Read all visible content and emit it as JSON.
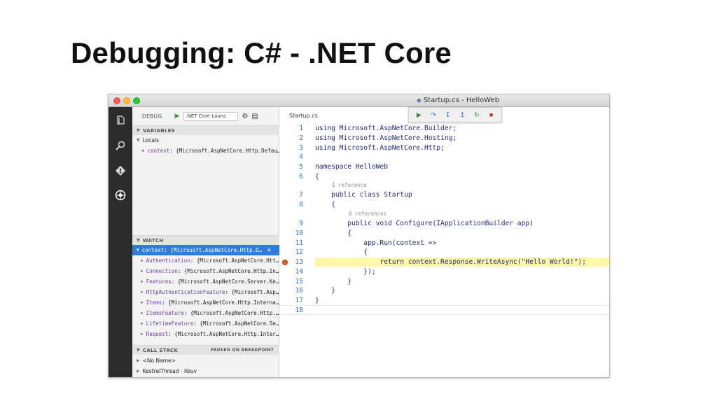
{
  "slide": {
    "title": "Debugging: C# - .NET Core"
  },
  "window": {
    "title": "Startup.cs - HelloWeb"
  },
  "activity_bar": {
    "icons": [
      "files-icon",
      "search-icon",
      "git-icon",
      "debug-icon"
    ]
  },
  "sidebar": {
    "debug_label": "DEBUG",
    "launch_config": ".NET Core Launc",
    "variables_header": "VARIABLES",
    "locals_label": "Locals",
    "locals": [
      {
        "key": "context",
        "value": ": {Microsoft.AspNetCore.Http.Defau…"
      }
    ],
    "watch_header": "WATCH",
    "watch_items": [
      {
        "key": "context",
        "value": ": {Microsoft.AspNetCore.Http.D…"
      },
      {
        "key": "Authentication",
        "value": ": {Microsoft.AspNetCore.Htt…"
      },
      {
        "key": "Connection",
        "value": ": {Microsoft.AspNetCore.Http.In…"
      },
      {
        "key": "Features",
        "value": ": {Microsoft.AspNetCore.Server.Ke…"
      },
      {
        "key": "HttpAuthenticationFeature",
        "value": ": {Microsoft.Asp…"
      },
      {
        "key": "Items",
        "value": ": {Microsoft.AspNetCore.Http.Interna…"
      },
      {
        "key": "ItemsFeature",
        "value": ": {Microsoft.AspNetCore.Http.…"
      },
      {
        "key": "LifetimeFeature",
        "value": ": {Microsoft.AspNetCore.Se…"
      },
      {
        "key": "Request",
        "value": ": {Microsoft.AspNetCore.Http.Inter…"
      }
    ],
    "callstack_header": "CALL STACK",
    "callstack_status": "PAUSED ON BREAKPOINT",
    "callstack_items": [
      "<No Name>",
      "KestrelThread - libuv"
    ]
  },
  "editor": {
    "tab": "Startup.cs",
    "codelens": [
      "1 reference",
      "0 references"
    ],
    "lines": [
      {
        "n": "1",
        "text": "using Microsoft.AspNetCore.Builder;"
      },
      {
        "n": "2",
        "text": "using Microsoft.AspNetCore.Hosting;"
      },
      {
        "n": "3",
        "text": "using Microsoft.AspNetCore.Http;"
      },
      {
        "n": "4",
        "text": ""
      },
      {
        "n": "5",
        "text": "namespace HelloWeb"
      },
      {
        "n": "6",
        "text": "{"
      },
      {
        "n": "7",
        "text": "    public class Startup"
      },
      {
        "n": "8",
        "text": "    {"
      },
      {
        "n": "9",
        "text": "        public void Configure(IApplicationBuilder app)"
      },
      {
        "n": "10",
        "text": "        {"
      },
      {
        "n": "11",
        "text": "            app.Run(context =>"
      },
      {
        "n": "12",
        "text": "            {"
      },
      {
        "n": "13",
        "text": "                return context.Response.WriteAsync(\"Hello World!\");"
      },
      {
        "n": "14",
        "text": "            });"
      },
      {
        "n": "15",
        "text": "        }"
      },
      {
        "n": "16",
        "text": "    }"
      },
      {
        "n": "17",
        "text": "}"
      },
      {
        "n": "18",
        "text": ""
      }
    ]
  },
  "colors": {
    "line_numbers": "#2b78c8",
    "selection": "#2f7dd9",
    "breakpoint": "#e05a2a",
    "current_line_highlight": "#fff7a8"
  }
}
